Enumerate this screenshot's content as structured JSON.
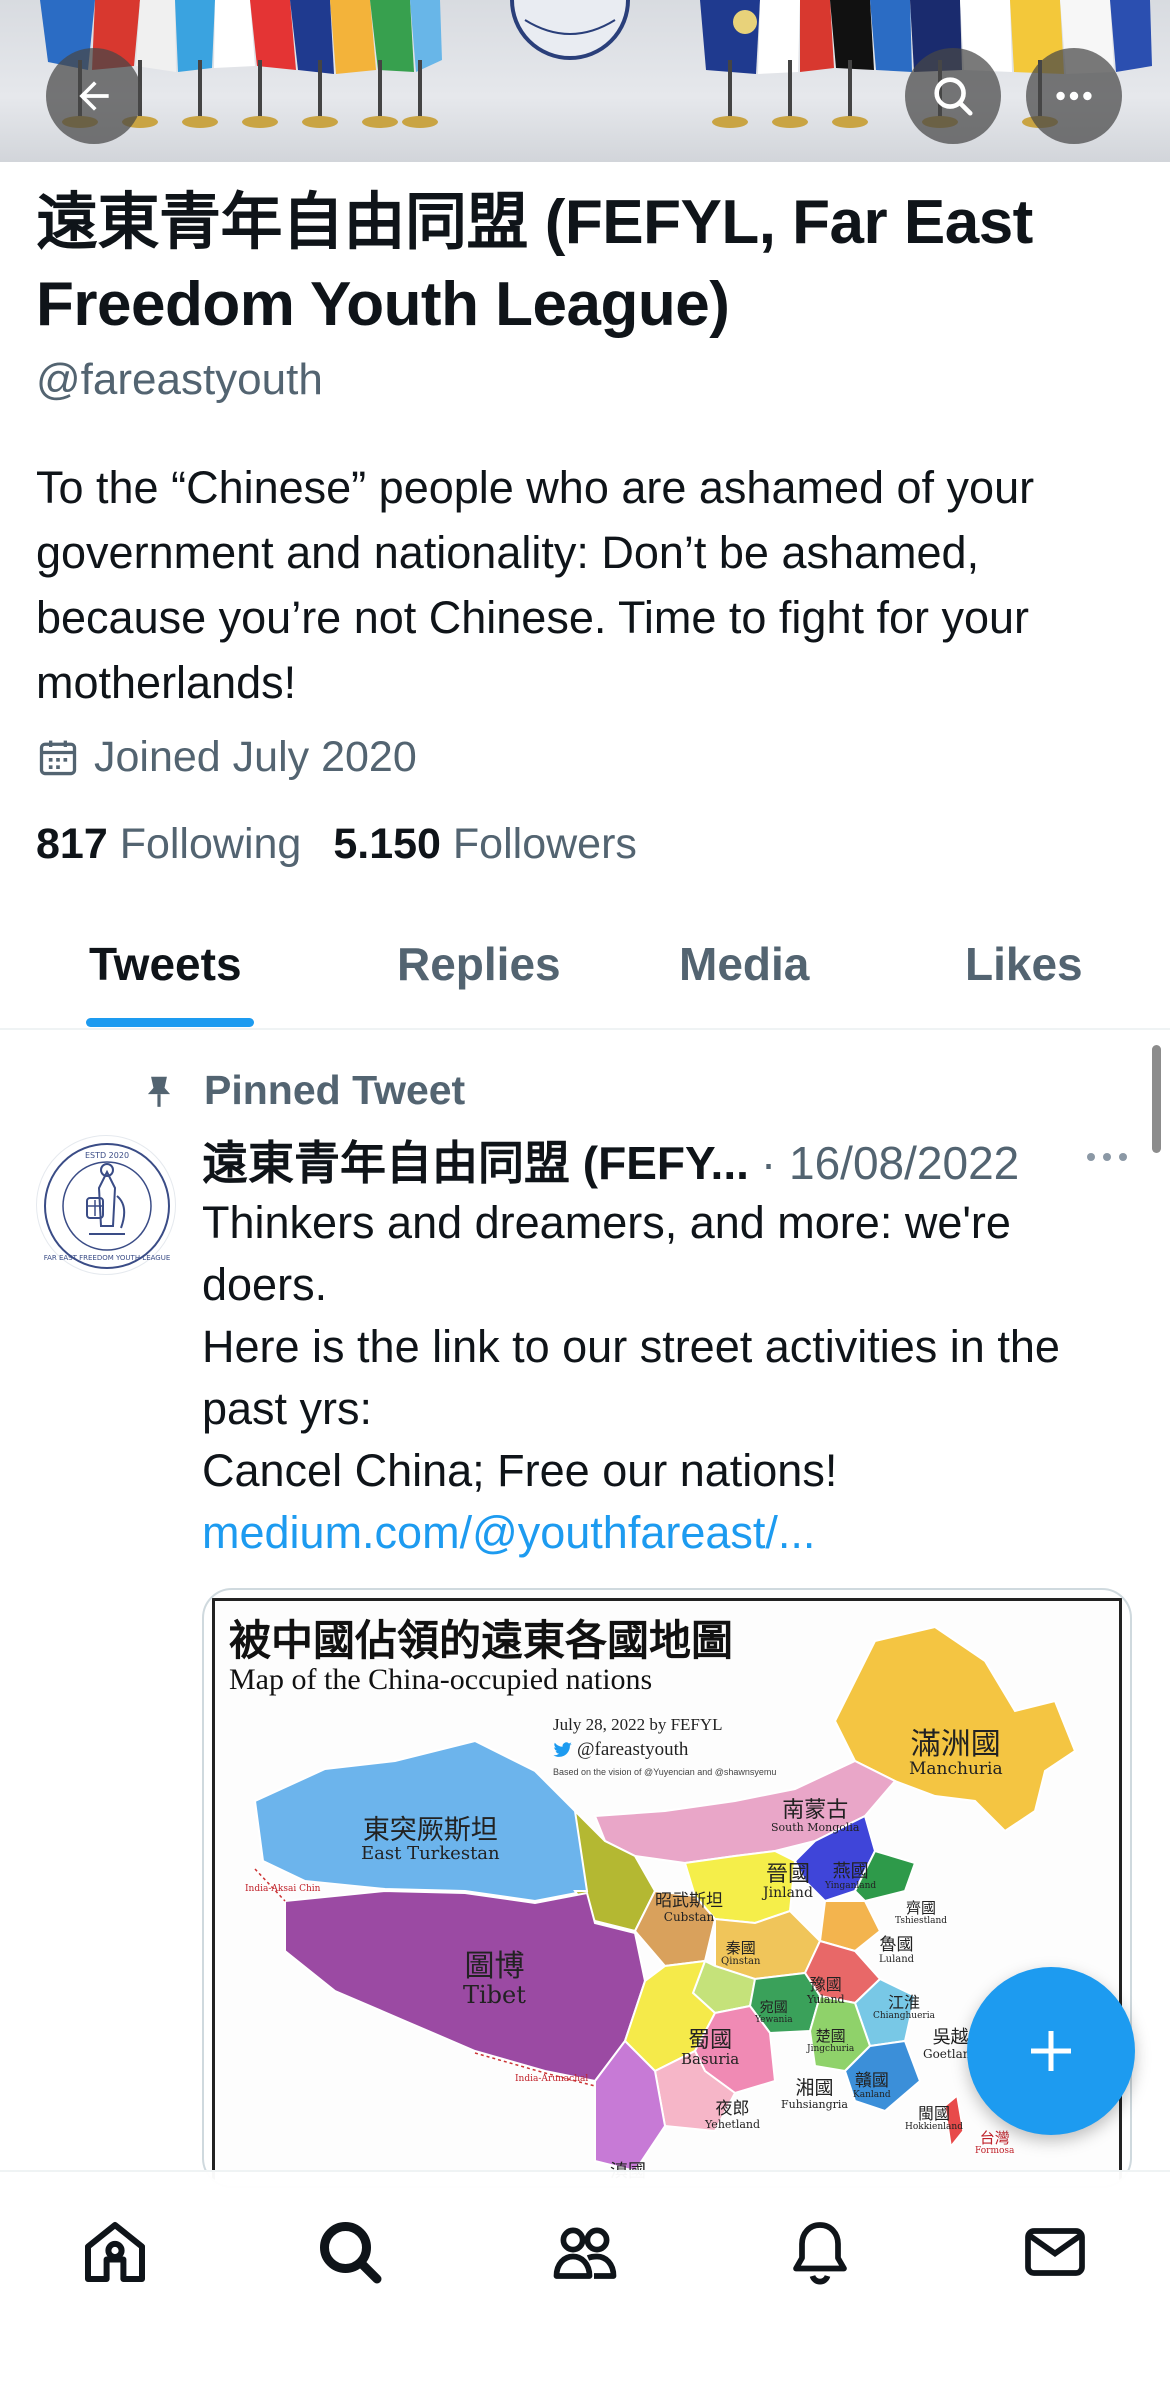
{
  "profile": {
    "display_name": "遠東青年自由同盟 (FEFYL, Far East Freedom Youth League)",
    "handle": "@fareastyouth",
    "bio": "To the “Chinese” people who are ashamed of your government and nationality: Don’t be ashamed, because you’re not Chinese. Time to fight for your motherlands!",
    "joined": "Joined July 2020",
    "following_count": "817",
    "following_label": "Following",
    "followers_count": "5.150",
    "followers_label": "Followers"
  },
  "tabs": [
    {
      "label": "Tweets",
      "active": true
    },
    {
      "label": "Replies",
      "active": false
    },
    {
      "label": "Media",
      "active": false
    },
    {
      "label": "Likes",
      "active": false
    }
  ],
  "tweet": {
    "pinned_label": "Pinned Tweet",
    "author": "遠東青年自由同盟 (FEFY...",
    "date": "· 16/08/2022",
    "lines": [
      "Thinkers and dreamers, and more: we're doers.",
      "Here is the link to our street activities in the past yrs:",
      "Cancel China; Free our nations!"
    ],
    "link": "medium.com/@youthfareast/..."
  },
  "map_image": {
    "title_zh": "被中國佔領的遠東各國地圖",
    "title_en": "Map of the China-occupied nations",
    "date_line": "July 28, 2022 by FEFYL",
    "handle_line": "@fareastyouth",
    "vision_line": "Based on the vision of @Yuyencian and @shawnsyemu",
    "regions": [
      {
        "zh": "滿洲國",
        "en": "Manchuria",
        "color": "#f4c542"
      },
      {
        "zh": "南蒙古",
        "en": "South Mongolia",
        "color": "#e9a6c8"
      },
      {
        "zh": "東突厥斯坦",
        "en": "East Turkestan",
        "color": "#6cb4ec"
      },
      {
        "zh": "圖博",
        "en": "Tibet",
        "color": "#9b4aa3"
      },
      {
        "zh": "晉國",
        "en": "Jinland",
        "color": "#f5ee4a"
      },
      {
        "zh": "昭武斯坦",
        "en": "Cubstan",
        "color": "#b4b832"
      },
      {
        "zh": "秦國",
        "en": "Qinstan",
        "color": "#d9a15c"
      },
      {
        "zh": "豫國",
        "en": "Yuland",
        "color": "#f0c55a"
      },
      {
        "zh": "蜀國",
        "en": "Basuria",
        "color": "#f5ea4a"
      },
      {
        "zh": "湘國",
        "en": "Fuhsiangria",
        "color": "#f08ab4"
      },
      {
        "zh": "夜郎",
        "en": "Yehetland",
        "color": "#f6b6c8"
      },
      {
        "zh": "魯國",
        "en": "Luland",
        "color": "#f3b44e"
      },
      {
        "zh": "吳越",
        "en": "Goetland",
        "color": "#78c8e6"
      },
      {
        "zh": "閩國",
        "en": "Hokkienland",
        "color": "#3b8fd9"
      },
      {
        "zh": "贛國",
        "en": "Kanland",
        "color": "#8fd26a"
      },
      {
        "zh": "楚國",
        "en": "Jingchuria",
        "color": "#3aa15a"
      },
      {
        "zh": "宛國",
        "en": "Yewania",
        "color": "#c5e27a"
      },
      {
        "zh": "江淮",
        "en": "Chianghueria",
        "color": "#e86868"
      },
      {
        "zh": "燕國",
        "en": "Yinganland",
        "color": "#3f45d9"
      },
      {
        "zh": "齊國",
        "en": "Tshiestland",
        "color": "#2e9a4a"
      },
      {
        "zh": "台灣",
        "en": "Formosa",
        "color": "#e84a4a"
      },
      {
        "zh": "滇國",
        "en": "",
        "color": "#c77ad6"
      }
    ],
    "india_aksai_chin": "India-Aksai Chin",
    "india_arunachal": "India-Arunachal"
  },
  "nav": [
    {
      "name": "home-icon"
    },
    {
      "name": "search-icon"
    },
    {
      "name": "communities-icon"
    },
    {
      "name": "notifications-icon"
    },
    {
      "name": "messages-icon"
    }
  ],
  "colors": {
    "accent": "#1d9bf0",
    "text_primary": "#0f1419",
    "text_secondary": "#536471"
  }
}
